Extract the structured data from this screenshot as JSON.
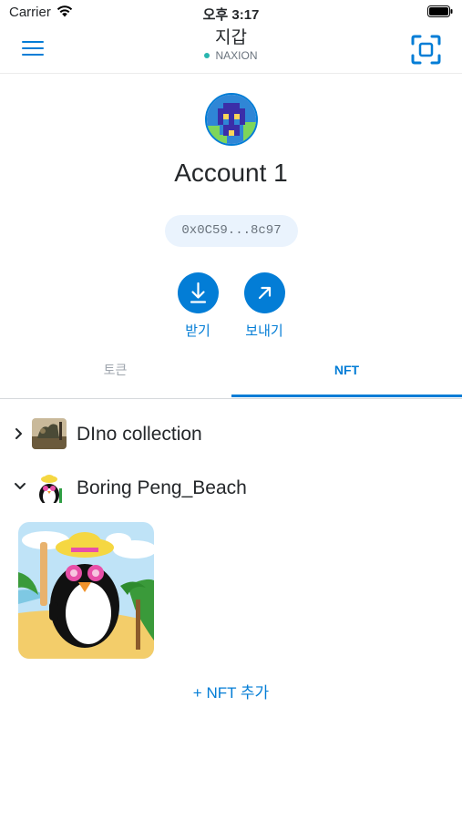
{
  "status_bar": {
    "carrier": "Carrier",
    "time": "오후 3:17"
  },
  "header": {
    "title": "지갑",
    "network": "NAXION"
  },
  "account": {
    "name": "Account 1",
    "address": "0x0C59...8c97"
  },
  "actions": {
    "receive": "받기",
    "send": "보내기"
  },
  "tabs": [
    {
      "label": "토큰",
      "active": false
    },
    {
      "label": "NFT",
      "active": true
    }
  ],
  "collections": [
    {
      "name": "DIno collection",
      "expanded": false
    },
    {
      "name": "Boring Peng_Beach",
      "expanded": true
    }
  ],
  "add_nft": "+ NFT 추가",
  "colors": {
    "accent": "#037dd6",
    "network_dot": "#29b6af",
    "muted": "#9fa6ae"
  }
}
